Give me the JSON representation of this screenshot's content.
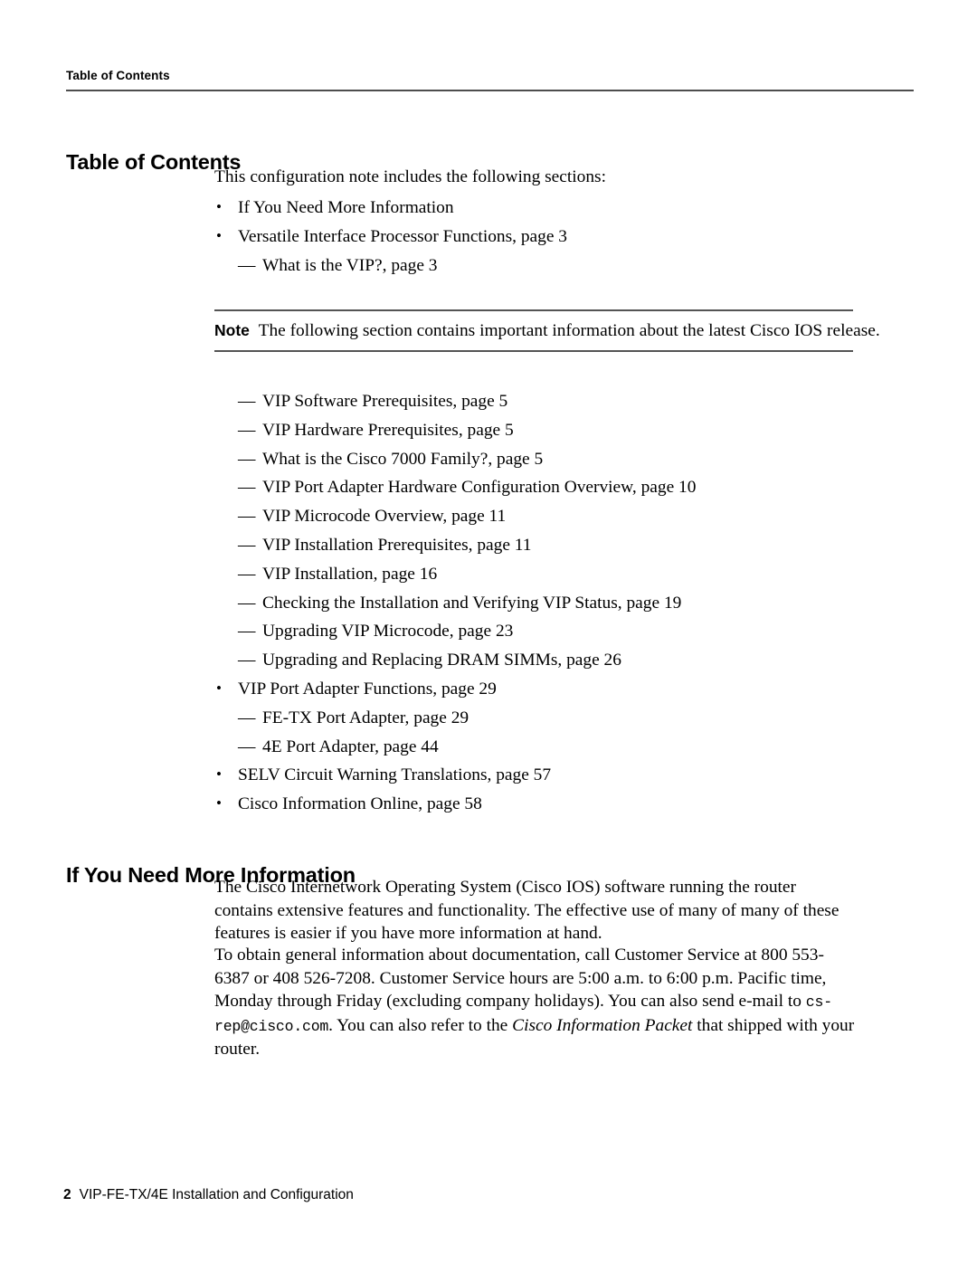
{
  "page": {
    "running_head": "Table of Contents",
    "number": "2",
    "footer_title": "VIP-FE-TX/4E Installation and Configuration"
  },
  "sections": {
    "toc": {
      "heading": "Table of Contents",
      "intro": "This configuration note includes the following sections:"
    },
    "more_info": {
      "heading": "If You Need More Information"
    }
  },
  "toc_list_top": [
    {
      "level": 1,
      "marker": "bullet",
      "text": "If You Need More Information"
    },
    {
      "level": 1,
      "marker": "bullet",
      "text": "Versatile Interface Processor Functions, page 3"
    },
    {
      "level": 2,
      "marker": "em-dash",
      "text": "What is the VIP?, page 3"
    }
  ],
  "note": {
    "label": "Note",
    "text": "The following section contains important information about the latest Cisco IOS release."
  },
  "toc_list_bottom": [
    {
      "level": 2,
      "marker": "em-dash",
      "text": "VIP Software Prerequisites, page 5"
    },
    {
      "level": 2,
      "marker": "em-dash",
      "text": "VIP Hardware Prerequisites, page 5"
    },
    {
      "level": 2,
      "marker": "em-dash",
      "text": "What is the Cisco 7000 Family?, page 5"
    },
    {
      "level": 2,
      "marker": "em-dash",
      "text": "VIP Port Adapter Hardware Configuration Overview, page 10"
    },
    {
      "level": 2,
      "marker": "em-dash",
      "text": "VIP Microcode Overview, page 11"
    },
    {
      "level": 2,
      "marker": "em-dash",
      "text": "VIP Installation Prerequisites, page 11"
    },
    {
      "level": 2,
      "marker": "em-dash",
      "text": "VIP Installation, page 16"
    },
    {
      "level": 2,
      "marker": "em-dash",
      "text": "Checking the Installation and Verifying VIP Status, page 19"
    },
    {
      "level": 2,
      "marker": "em-dash",
      "text": "Upgrading VIP Microcode, page 23"
    },
    {
      "level": 2,
      "marker": "em-dash",
      "text": "Upgrading and Replacing DRAM SIMMs, page 26"
    },
    {
      "level": 1,
      "marker": "bullet",
      "text": "VIP Port Adapter Functions, page 29"
    },
    {
      "level": 2,
      "marker": "em-dash",
      "text": "FE-TX Port Adapter, page 29"
    },
    {
      "level": 2,
      "marker": "em-dash",
      "text": "4E Port Adapter, page 44"
    },
    {
      "level": 1,
      "marker": "bullet",
      "text": "SELV Circuit Warning Translations, page 57"
    },
    {
      "level": 1,
      "marker": "bullet",
      "text": "Cisco Information Online, page 58"
    }
  ],
  "paragraphs": {
    "p1": "The Cisco Internetwork Operating System (Cisco IOS) software running the router contains extensive features and functionality. The effective use of many of many of these features is easier if you have more information at hand.",
    "p2_part1": "To obtain general information about documentation, call Customer Service at 800 553-6387 or 408 526-7208. Customer Service hours are 5:00 a.m. to 6:00 p.m. Pacific time, Monday through Friday (excluding company holidays). You can also send e-mail to ",
    "p2_email": "cs-rep@cisco.com",
    "p2_part2": ". You can also refer to the ",
    "p2_italic": "Cisco Information Packet",
    "p2_part3": " that shipped with your router."
  },
  "markers": {
    "bullet": "•",
    "em_dash": "—"
  },
  "colors": {
    "text": "#000000",
    "rule": "#4d4d4d",
    "background": "#ffffff"
  }
}
